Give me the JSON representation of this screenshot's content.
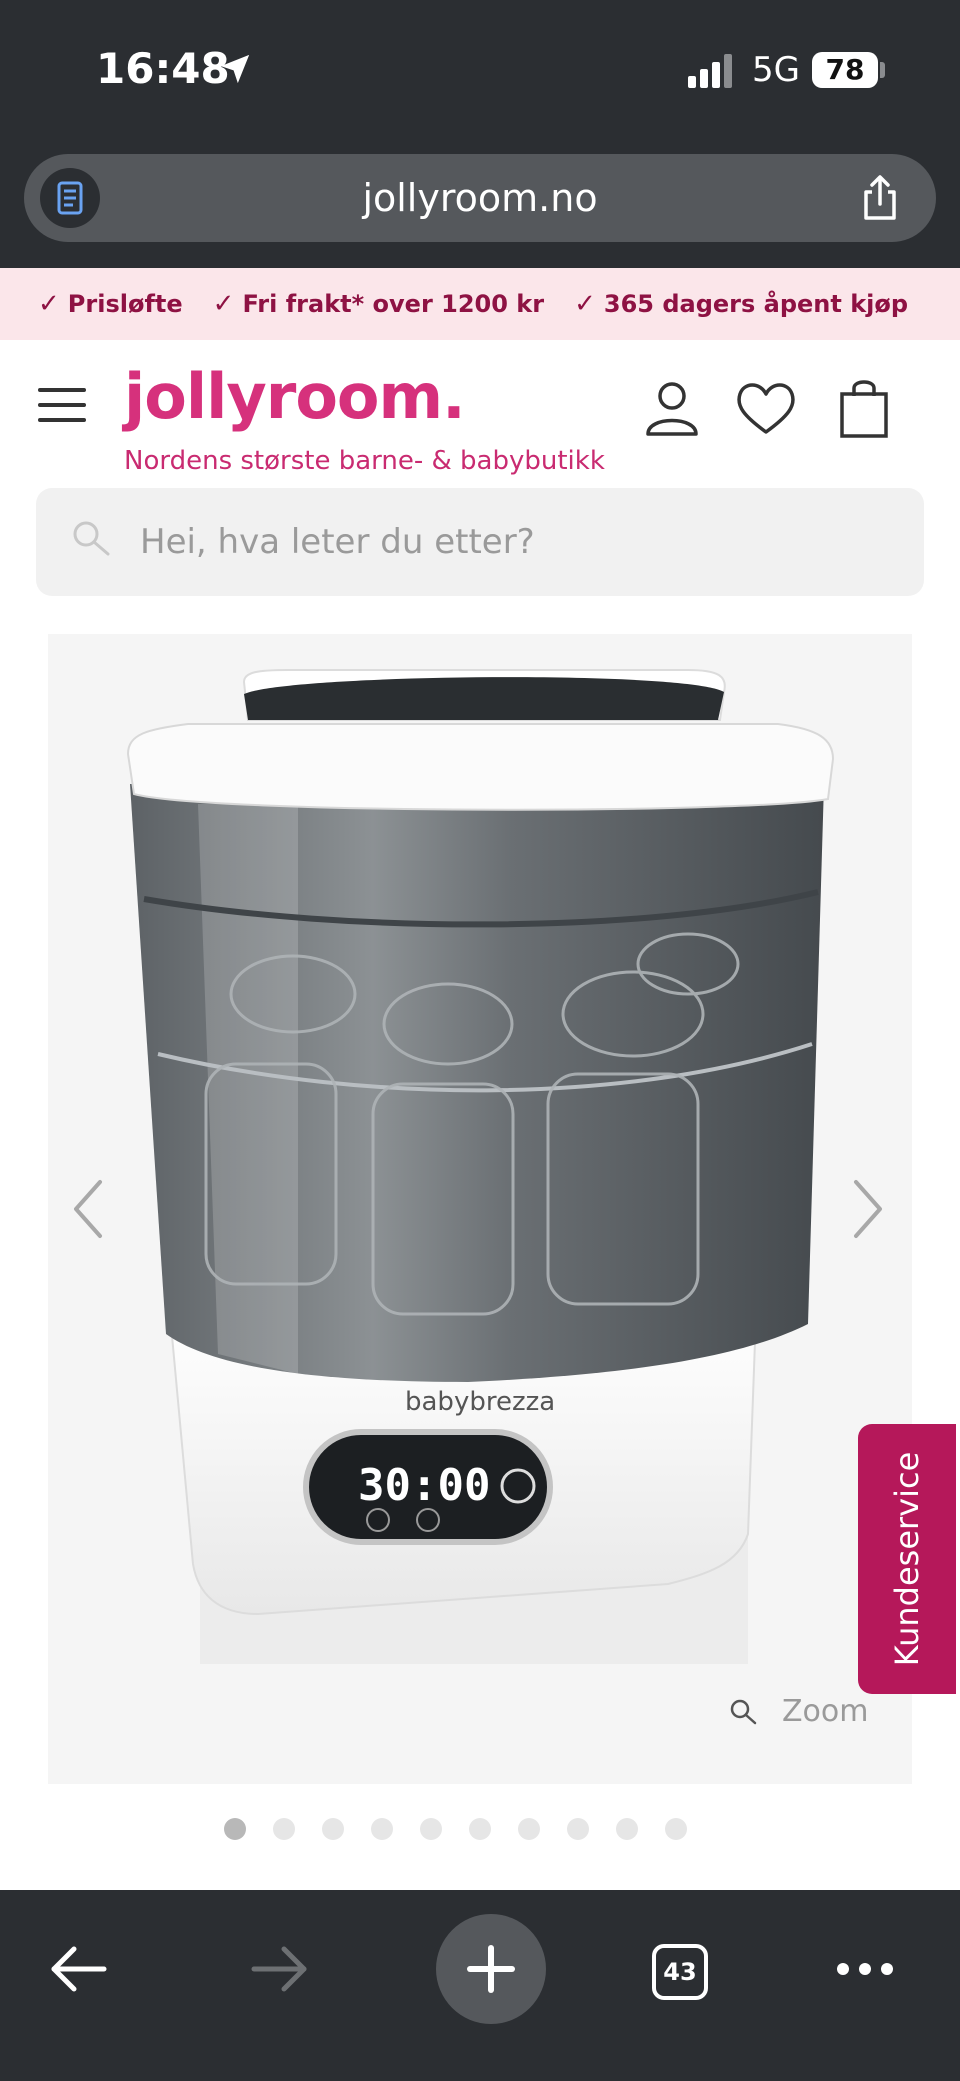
{
  "status_bar": {
    "time": "16:48",
    "network": "5G",
    "battery": "78"
  },
  "browser": {
    "url": "jollyroom.no",
    "tab_count": "43"
  },
  "usp": [
    {
      "label": "Prisløfte"
    },
    {
      "label": "Fri frakt* over 1200 kr"
    },
    {
      "label": "365 dagers åpent kjøp"
    }
  ],
  "header": {
    "logo": "jollyroom.",
    "tagline": "Nordens største barne- & babybutikk"
  },
  "search": {
    "placeholder": "Hei, hva leter du etter?"
  },
  "gallery": {
    "zoom_label": "Zoom",
    "product_brand_on_device": "babybrezza",
    "device_display": "30:00",
    "image_count": 10,
    "active_index": 1
  },
  "customer_service": {
    "label": "Kundeservice"
  },
  "colors": {
    "brand_pink": "#d6317c",
    "usp_bg": "#fbe6ea",
    "service_tab": "#b5185a",
    "browser_chrome": "#2b2e32"
  },
  "icons": [
    "location-arrow-icon",
    "signal-icon",
    "battery-icon",
    "reader-icon",
    "share-icon",
    "checkmark-icon",
    "menu-icon",
    "account-icon",
    "wishlist-heart-icon",
    "cart-bag-icon",
    "search-icon",
    "chevron-left-icon",
    "chevron-right-icon",
    "zoom-icon",
    "back-arrow-icon",
    "forward-arrow-icon",
    "new-tab-plus-icon",
    "tabs-icon",
    "more-icon"
  ]
}
